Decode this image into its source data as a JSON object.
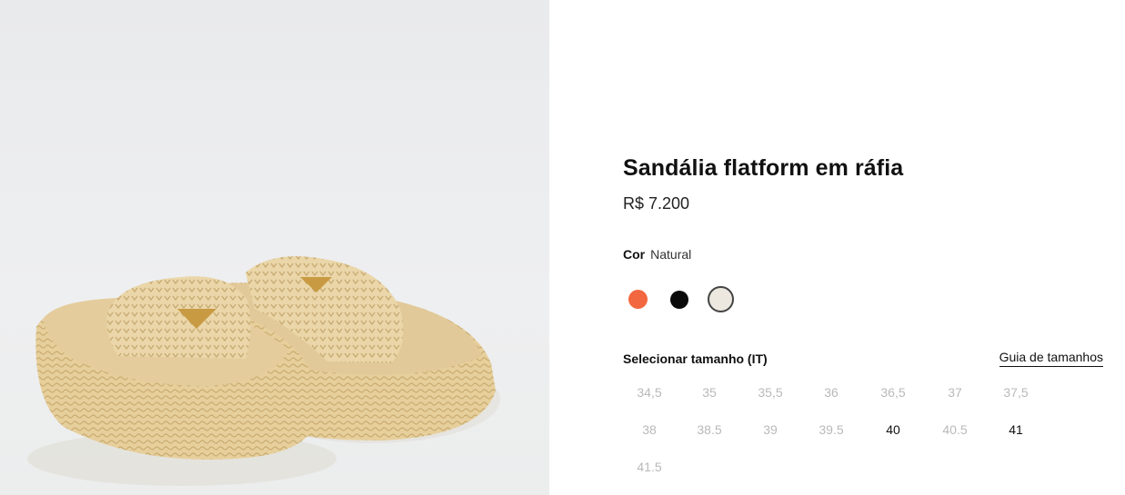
{
  "product": {
    "title": "Sandália flatform em ráfia",
    "price": "R$ 7.200",
    "image_icon": "raffia-flatform-slide-sandals-image"
  },
  "color": {
    "label": "Cor",
    "selected": "Natural",
    "swatches": [
      {
        "name": "orange",
        "hex": "#f2673f",
        "selected": false
      },
      {
        "name": "black",
        "hex": "#0a0a0a",
        "selected": false
      },
      {
        "name": "natural",
        "hex": "#ece8df",
        "selected": true
      }
    ]
  },
  "size": {
    "label": "Selecionar tamanho (IT)",
    "guide_link": "Guia de tamanhos",
    "options": [
      {
        "label": "34,5",
        "available": false
      },
      {
        "label": "35",
        "available": false
      },
      {
        "label": "35,5",
        "available": false
      },
      {
        "label": "36",
        "available": false
      },
      {
        "label": "36,5",
        "available": false
      },
      {
        "label": "37",
        "available": false
      },
      {
        "label": "37,5",
        "available": false
      },
      {
        "label": "38",
        "available": false
      },
      {
        "label": "38.5",
        "available": false
      },
      {
        "label": "39",
        "available": false
      },
      {
        "label": "39.5",
        "available": false
      },
      {
        "label": "40",
        "available": true
      },
      {
        "label": "40.5",
        "available": false
      },
      {
        "label": "41",
        "available": true
      },
      {
        "label": "41.5",
        "available": false
      }
    ]
  }
}
